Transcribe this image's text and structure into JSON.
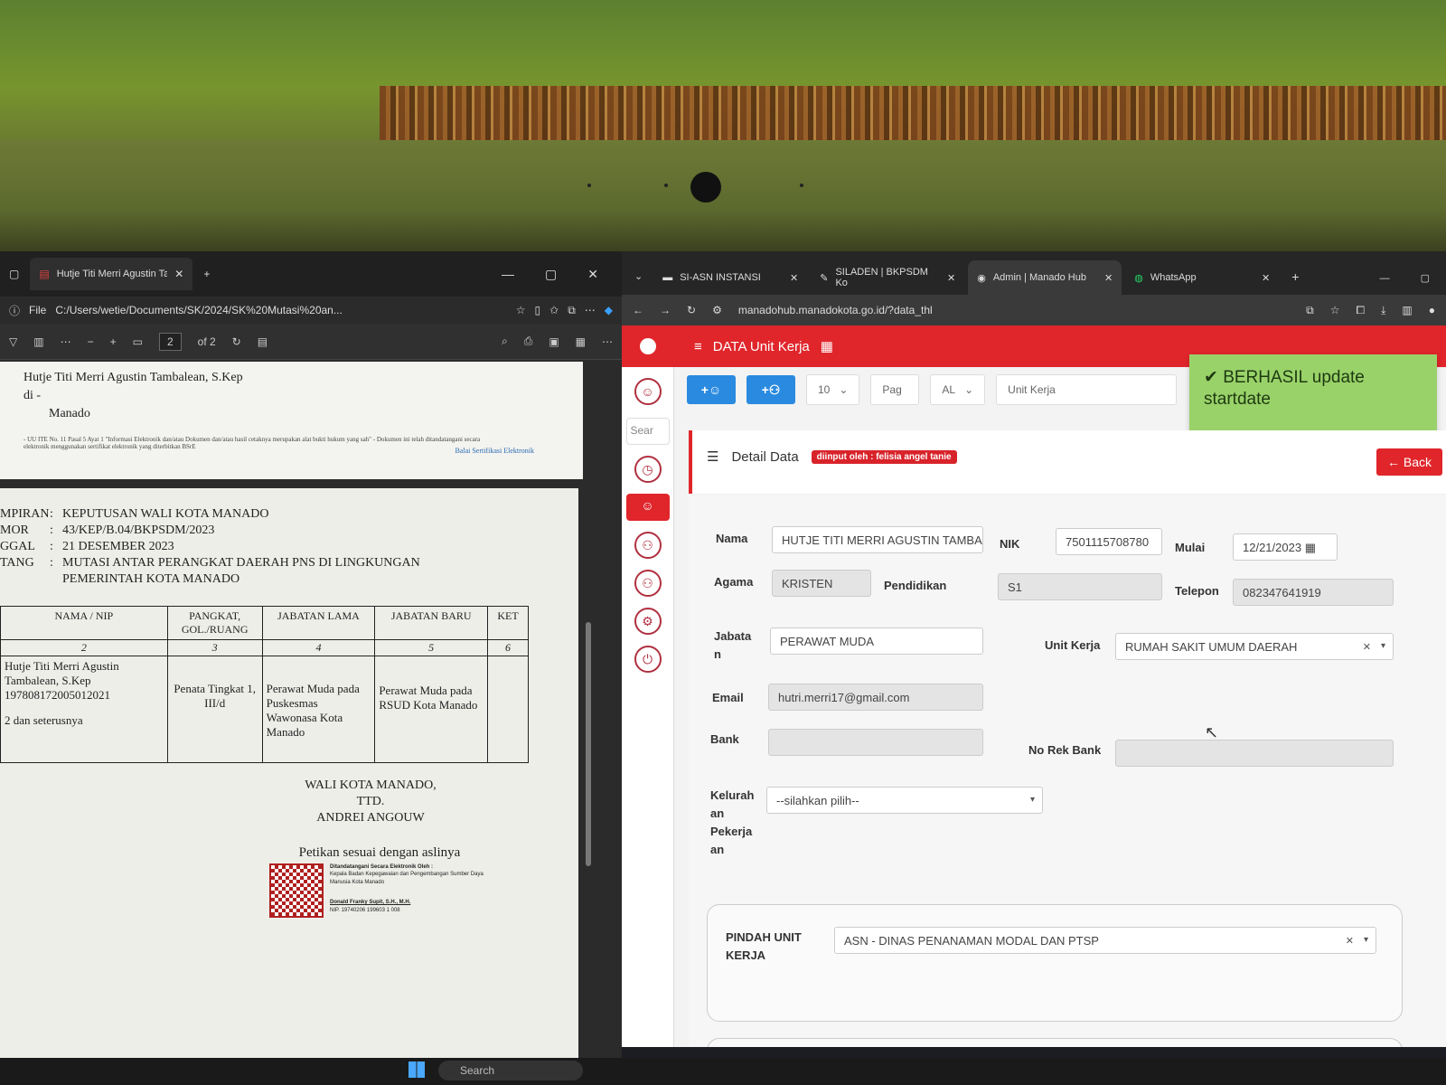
{
  "pdf": {
    "tab_title": "Hutje Titi Merri Agustin Tambale",
    "file_label": "File",
    "path": "C:/Users/wetie/Documents/SK/2024/SK%20Mutasi%20an...",
    "page_current": "2",
    "page_total": "of 2",
    "addressee": [
      "Hutje Titi Merri Agustin Tambalean, S.Kep",
      "di -",
      "Manado"
    ],
    "notice": "- UU ITE No. 11 Pasal 5 Ayat 1 \"Informasi Elektronik dan/atau Dokumen dan/atau hasil cetaknya merupakan alat bukti hukum yang sah\" - Dokumen ini telah ditandatangani secara elektronik menggunakan sertifikat elektronik yang diterbitkan BSrE",
    "bsre": "Balai Sertifikasi Elektronik",
    "meta": [
      {
        "k": "MPIRAN",
        "v": "KEPUTUSAN WALI KOTA MANADO"
      },
      {
        "k": "MOR",
        "v": "43/KEP/B.04/BKPSDM/2023"
      },
      {
        "k": "GGAL",
        "v": "21 DESEMBER 2023"
      },
      {
        "k": "TANG",
        "v": "MUTASI ANTAR PERANGKAT DAERAH PNS DI LINGKUNGAN"
      },
      {
        "k": "",
        "v": "PEMERINTAH KOTA MANADO"
      }
    ],
    "table_headers": [
      "NAMA / NIP",
      "PANGKAT, GOL./RUANG",
      "JABATAN LAMA",
      "JABATAN BARU",
      "KET"
    ],
    "table_numbers": [
      "2",
      "3",
      "4",
      "5",
      "6"
    ],
    "row": {
      "nama": "Hutje Titi Merri Agustin Tambalean, S.Kep 197808172005012021",
      "extra": "2 dan seterusnya",
      "pangkat": "Penata Tingkat 1, III/d",
      "lama": "Perawat Muda pada Puskesmas Wawonasa Kota Manado",
      "baru": "Perawat Muda pada RSUD Kota Manado",
      "ket": ""
    },
    "sign": [
      "WALI KOTA MANADO,",
      "TTD.",
      "ANDREI ANGOUW"
    ],
    "petikan": "Petikan sesuai dengan aslinya",
    "signer": [
      "Ditandatangani Secara Elektronik Oleh :",
      "Kepala Badan Kepegawaian dan Pengembangan Sumber Daya Manusia Kota Manado",
      "Donald Franky Supit, S.H., M.H.",
      "NIP. 19740206 199603 1 008"
    ]
  },
  "browser": {
    "tabs": [
      {
        "label": "SI-ASN INSTANSI"
      },
      {
        "label": "SILADEN | BKPSDM Ko"
      },
      {
        "label": "Admin | Manado Hub"
      },
      {
        "label": "WhatsApp"
      }
    ],
    "url": "manadohub.manadokota.go.id/?data_thl",
    "header_title": "DATA Unit Kerja",
    "search_placeholder": "Sear",
    "page_size": "10",
    "page_placeholder": "Pag",
    "filter_al": "AL",
    "unit_placeholder": "Unit Kerja",
    "toast": "BERHASIL update startdate",
    "detail_title": "Detail Data",
    "badge": "diinput oleh : felisia angel tanie",
    "back": "Back",
    "labels": {
      "nama": "Nama",
      "nik": "NIK",
      "mulai": "Mulai",
      "agama": "Agama",
      "pendidikan": "Pendidikan",
      "telepon": "Telepon",
      "jabatan": "Jabata n",
      "unit_kerja": "Unit Kerja",
      "email": "Email",
      "bank": "Bank",
      "no_rek": "No Rek Bank",
      "kelurahan": "Kelurah an Pekerja an",
      "pindah": "PINDAH UNIT KERJA"
    },
    "values": {
      "nama": "HUTJE TITI MERRI AGUSTIN TAMBALE",
      "nik": "7501115708780",
      "mulai": "12/21/2023",
      "agama": "KRISTEN",
      "pendidikan": "S1",
      "telepon": "082347641919",
      "jabatan": "PERAWAT MUDA",
      "unit_kerja": "RUMAH SAKIT UMUM DAERAH",
      "email": "hutri.merri17@gmail.com",
      "bank": "",
      "no_rek": "",
      "kelurahan": "--silahkan pilih--",
      "pindah": "ASN - DINAS PENANAMAN MODAL DAN PTSP"
    }
  },
  "taskbar": {
    "search": "Search"
  },
  "colors": {
    "accent_red": "#e0262b",
    "accent_blue": "#2a8ae0",
    "toast_green": "#9ad26a"
  }
}
